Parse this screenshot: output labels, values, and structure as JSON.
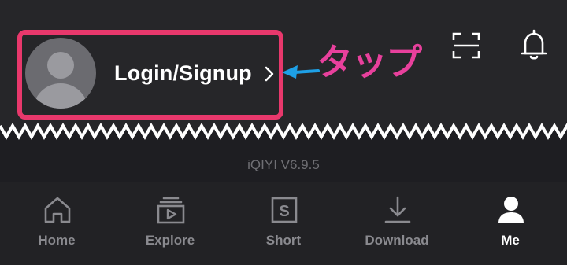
{
  "profile": {
    "login_label": "Login/Signup"
  },
  "annotation": {
    "text": "タップ",
    "color": "#e8409c",
    "arrow_color": "#1ea0e6",
    "highlight_color": "#e8386c"
  },
  "header": {
    "icons": [
      "scan-icon",
      "bell-icon"
    ]
  },
  "version_text": "iQIYI V6.9.5",
  "tabbar": {
    "tabs": [
      {
        "label": "Home",
        "icon": "home-icon",
        "active": false
      },
      {
        "label": "Explore",
        "icon": "explore-icon",
        "active": false
      },
      {
        "label": "Short",
        "icon": "short-icon",
        "active": false
      },
      {
        "label": "Download",
        "icon": "download-icon",
        "active": false
      },
      {
        "label": "Me",
        "icon": "person-icon",
        "active": true
      }
    ]
  }
}
